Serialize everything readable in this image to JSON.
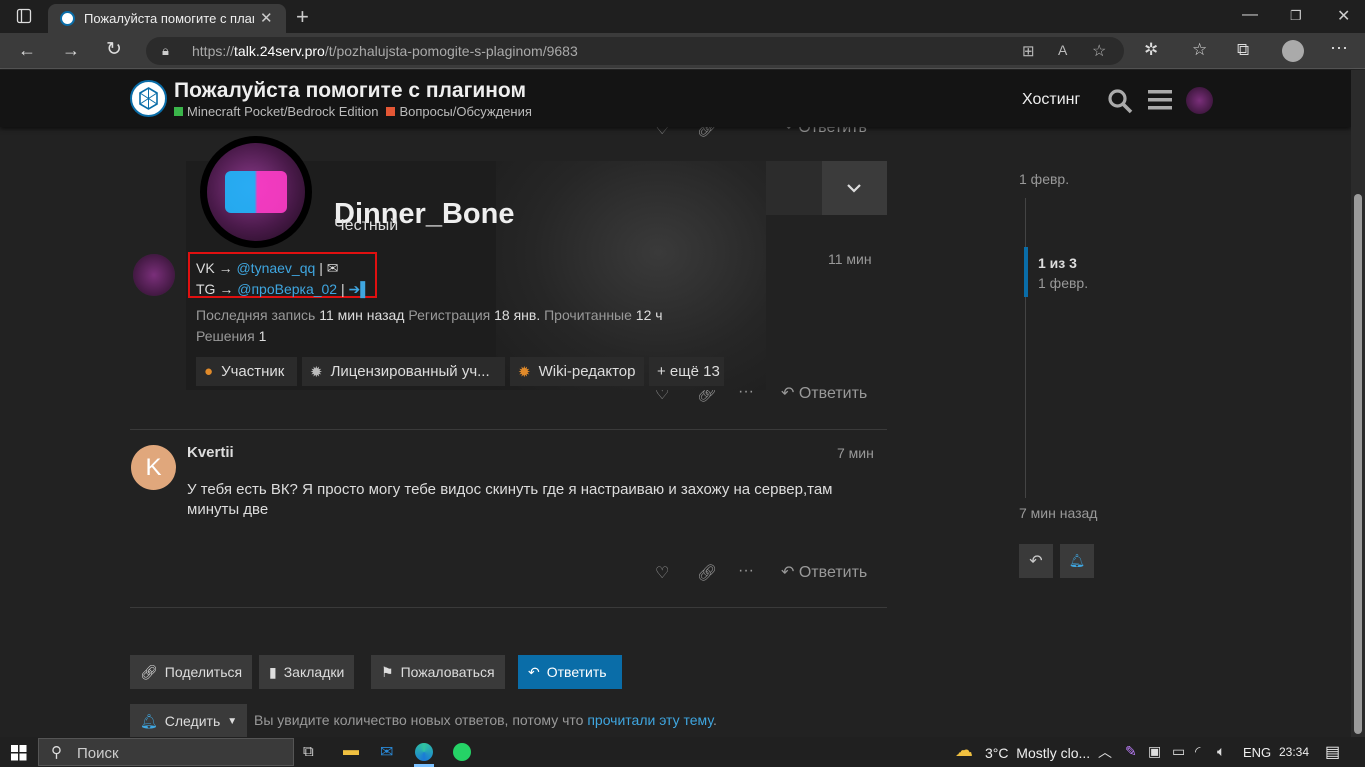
{
  "browser": {
    "tab_title": "Пожалуйста помогите с плагин",
    "url_prefix": "https://",
    "url_domain": "talk.24serv.pro",
    "url_path": "/t/pozhalujsta-pomogite-s-plaginom/9683"
  },
  "header": {
    "topic_title": "Пожалуйста помогите с плагином",
    "category_1": "Minecraft Pocket/Bedrock Edition",
    "category_1_color": "#3ab54a",
    "category_2": "Вопросы/Обсуждения",
    "category_2_color": "#e45735",
    "hosting_link": "Хостинг"
  },
  "upper_post": {
    "reply_label": "Ответить",
    "time": "11 мин"
  },
  "user_card": {
    "username": "Dinner_Bone",
    "title": "Честный",
    "vk_prefix": "VK →",
    "vk_handle": "@tynaev_qq",
    "tg_prefix": "TG →",
    "tg_handle": "@проВерка_02",
    "separator": "|",
    "last_post_label": "Последняя запись",
    "last_post_value": "11 мин назад",
    "registered_label": "Регистрация",
    "registered_value": "18 янв.",
    "read_label": "Прочитанные",
    "read_value": "12 ч",
    "solutions_label": "Решения",
    "solutions_value": "1",
    "badges": [
      "Участник",
      "Лицензированный уч...",
      "Wiki-редактор"
    ],
    "more_badges": "+ ещё 13"
  },
  "post_kvertii": {
    "avatar_letter": "K",
    "avatar_color": "#e0a77c",
    "username": "Kvertii",
    "time": "7 мин",
    "text": "У тебя есть ВК? Я просто могу тебе видос скинуть где я настраиваю и захожу на сервер,там минуты две",
    "reply_label": "Ответить"
  },
  "footer_buttons": {
    "share": "Поделиться",
    "bookmarks": "Закладки",
    "flag": "Пожаловаться",
    "reply": "Ответить",
    "follow": "Следить",
    "notice_text": "Вы увидите количество новых ответов, потому что",
    "notice_link": "прочитали эту тему",
    "notice_end": "."
  },
  "timeline": {
    "start_date": "1 февр.",
    "position": "1 из 3",
    "position_date": "1 февр.",
    "end_label": "7 мин назад"
  },
  "taskbar": {
    "search_placeholder": "Поиск",
    "weather_temp": "3°C",
    "weather_text": "Mostly clo...",
    "language": "ENG",
    "time": "23:34"
  },
  "colors": {
    "accent": "#0a6da8",
    "link": "#3fa6e0",
    "highlight_box": "#e01010"
  }
}
